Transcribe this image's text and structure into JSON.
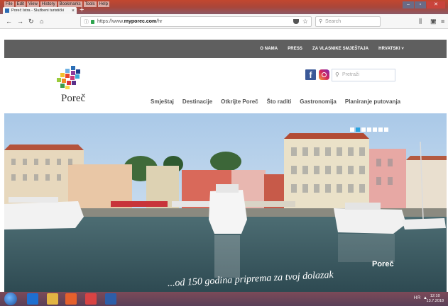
{
  "browser": {
    "menu": [
      "File",
      "Edit",
      "View",
      "History",
      "Bookmarks",
      "Tools",
      "Help"
    ],
    "tab_title": "Poreč Istra - Službeni turistički",
    "tab_close": "×",
    "new_tab": "+",
    "url_host": "https://www.",
    "url_domain": "myporec.com",
    "url_path": "/hr",
    "url_more": "•••",
    "search_placeholder": "Search"
  },
  "site": {
    "top_links": [
      "O NAMA",
      "PRESS",
      "ZA VLASNIKE SMJEŠTAJA",
      "HRVATSKI ˅"
    ],
    "logo_text": "Poreč",
    "facebook_glyph": "f",
    "search_placeholder": "Pretraži",
    "nav": [
      "Smještaj",
      "Destinacije",
      "Otkrijte Poreč",
      "Što raditi",
      "Gastronomija",
      "Planiranje putovanja"
    ],
    "hero_label": "Poreč",
    "hero_caption": "...od 150 godina priprema za tvoj dolazak",
    "slider_count": 7,
    "slider_active": 1
  },
  "taskbar": {
    "tray": "HR ▲",
    "time": "12:10",
    "date": "13.7.2018"
  },
  "colors": {
    "site_bar": "#5f5f5f",
    "slider_active": "#2aa4df",
    "facebook": "#3b5998"
  }
}
